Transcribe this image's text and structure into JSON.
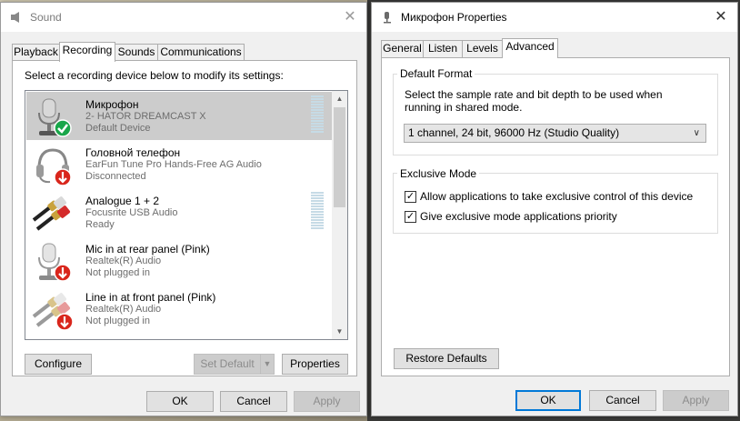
{
  "sound": {
    "title": "Sound",
    "tabs": [
      "Playback",
      "Recording",
      "Sounds",
      "Communications"
    ],
    "active_tab": "Recording",
    "instruction": "Select a recording device below to modify its settings:",
    "devices": [
      {
        "name": "Микрофон",
        "line1": "2- HATOR DREAMCAST X",
        "line2": "Default Device",
        "status_icon": "check-icon",
        "device_icon": "microphone-icon",
        "selected": true
      },
      {
        "name": "Головной телефон",
        "line1": "EarFun Tune Pro Hands-Free AG Audio",
        "line2": "Disconnected",
        "status_icon": "red-down-arrow-icon",
        "device_icon": "headset-icon"
      },
      {
        "name": "Analogue 1 + 2",
        "line1": "Focusrite USB Audio",
        "line2": "Ready",
        "device_icon": "rca-jack-icon"
      },
      {
        "name": "Mic in at rear panel (Pink)",
        "line1": "Realtek(R) Audio",
        "line2": "Not plugged in",
        "status_icon": "red-down-arrow-icon",
        "device_icon": "microphone-icon"
      },
      {
        "name": "Line in at front panel (Pink)",
        "line1": "Realtek(R) Audio",
        "line2": "Not plugged in",
        "status_icon": "red-down-arrow-icon",
        "device_icon": "rca-jack-icon"
      }
    ],
    "buttons": {
      "configure": "Configure",
      "set_default": "Set Default",
      "properties": "Properties",
      "ok": "OK",
      "cancel": "Cancel",
      "apply": "Apply"
    }
  },
  "props": {
    "title": "Микрофон Properties",
    "tabs": [
      "General",
      "Listen",
      "Levels",
      "Advanced"
    ],
    "active_tab": "Advanced",
    "default_format": {
      "title": "Default Format",
      "description": "Select the sample rate and bit depth to be used when running in shared mode.",
      "selected": "1 channel, 24 bit, 96000 Hz (Studio Quality)"
    },
    "exclusive": {
      "title": "Exclusive Mode",
      "opt1": "Allow applications to take exclusive control of this device",
      "opt1_checked": true,
      "opt2": "Give exclusive mode applications priority",
      "opt2_checked": true
    },
    "buttons": {
      "restore": "Restore Defaults",
      "ok": "OK",
      "cancel": "Cancel",
      "apply": "Apply"
    }
  },
  "colors": {
    "accent": "#0078d7",
    "selected_row": "#cccccc",
    "window_bg": "#f0f0f0"
  }
}
